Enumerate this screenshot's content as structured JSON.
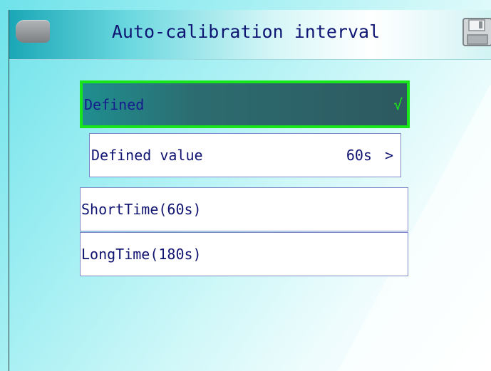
{
  "header": {
    "title": "Auto-calibration interval",
    "back_icon": "back-icon",
    "save_icon": "save-icon"
  },
  "options": {
    "defined": {
      "label": "Defined",
      "mark": "√",
      "selected": true
    },
    "defined_value": {
      "label": "Defined value",
      "value": "60s",
      "chevron": ">"
    },
    "short_time": {
      "label": "ShortTime(60s)"
    },
    "long_time": {
      "label": "LongTime(180s)"
    }
  },
  "colors": {
    "title_text": "#0f1573",
    "selection_border": "#19e61a",
    "selected_fill": "#2c6c70",
    "background_cyan": "#6fe2ea"
  }
}
